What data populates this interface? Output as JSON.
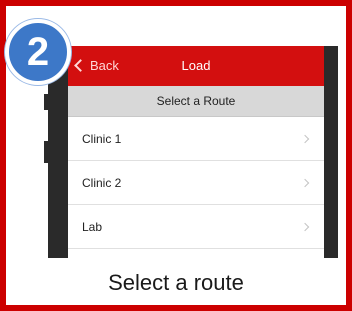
{
  "step": {
    "number": "2"
  },
  "navbar": {
    "back_label": "Back",
    "title": "Load"
  },
  "subheader": {
    "label": "Select a Route"
  },
  "routes": [
    {
      "label": "Clinic 1"
    },
    {
      "label": "Clinic 2"
    },
    {
      "label": "Lab"
    }
  ],
  "caption": "Select a route",
  "colors": {
    "frame": "#cc0000",
    "navbar": "#d30f0f",
    "badge": "#3d78c8"
  },
  "icons": {
    "back": "chevron-left-icon",
    "row": "chevron-right-icon"
  }
}
